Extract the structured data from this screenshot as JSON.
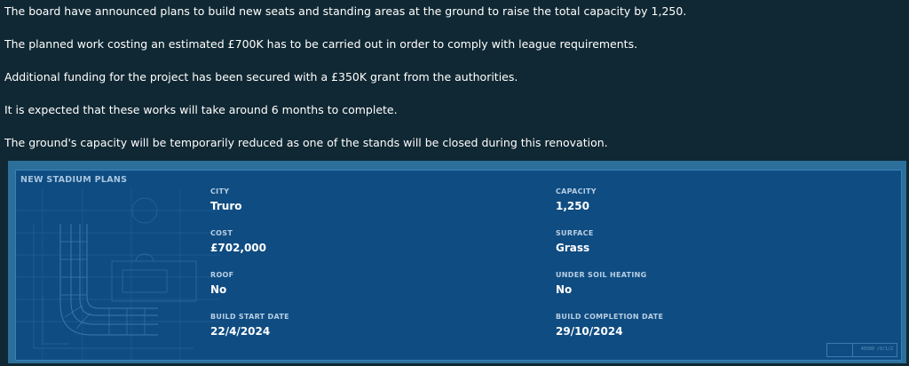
{
  "message": {
    "paragraphs": [
      "The board have announced plans to build new seats and standing areas at the ground to raise the total capacity by 1,250.",
      "The planned work costing an estimated £700K has to be carried out in order to comply with league requirements.",
      "Additional funding for the project has been secured with a £350K grant from the authorities.",
      "It is expected that these works will take around 6 months to complete.",
      "The ground's capacity will be temporarily reduced as one of the stands will be closed during this renovation."
    ]
  },
  "stadium_plans": {
    "title": "NEW STADIUM PLANS",
    "city": {
      "label": "CITY",
      "value": "Truro"
    },
    "cost": {
      "label": "COST",
      "value": "£702,000"
    },
    "roof": {
      "label": "ROOF",
      "value": "No"
    },
    "build_start": {
      "label": "BUILD START DATE",
      "value": "22/4/2024"
    },
    "capacity": {
      "label": "CAPACITY",
      "value": "1,250"
    },
    "surface": {
      "label": "SURFACE",
      "value": "Grass"
    },
    "under_soil_heating": {
      "label": "UNDER SOIL HEATING",
      "value": "No"
    },
    "build_completion": {
      "label": "BUILD COMPLETION DATE",
      "value": "29/10/2024"
    },
    "stamp_code": "40390 /0/1/2"
  },
  "colors": {
    "page_background": "#102833",
    "panel_frame": "#2c6f9b",
    "panel_background": "#0f4c82",
    "label_color": "#b8cfe3"
  }
}
